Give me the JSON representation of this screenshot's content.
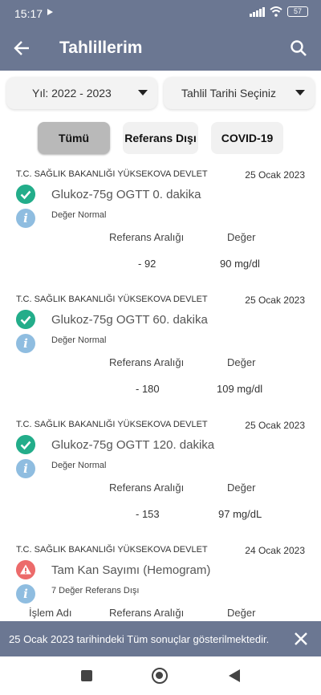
{
  "status_bar": {
    "time": "15:17",
    "battery": "57"
  },
  "app_bar": {
    "title": "Tahlillerim"
  },
  "filters": {
    "year": "Yıl: 2022 - 2023",
    "date": "Tahlil Tarihi Seçiniz"
  },
  "chips": [
    "Tümü",
    "Referans Dışı",
    "COVID-19"
  ],
  "results": [
    {
      "institution": "T.C. SAĞLIK BAKANLIĞI YÜKSEKOVA DEVLET",
      "date": "25 Ocak 2023",
      "test": "Glukoz-75g OGTT 0. dakika",
      "status": "ok",
      "info": "Değer Normal",
      "ref_header": "Referans Aralığı",
      "value_header": "Değer",
      "ref": "- 92",
      "value": "90 mg/dl"
    },
    {
      "institution": "T.C. SAĞLIK BAKANLIĞI YÜKSEKOVA DEVLET",
      "date": "25 Ocak 2023",
      "test": "Glukoz-75g OGTT 60. dakika",
      "status": "ok",
      "info": "Değer Normal",
      "ref_header": "Referans Aralığı",
      "value_header": "Değer",
      "ref": "- 180",
      "value": "109 mg/dl"
    },
    {
      "institution": "T.C. SAĞLIK BAKANLIĞI YÜKSEKOVA DEVLET",
      "date": "25 Ocak 2023",
      "test": "Glukoz-75g OGTT 120. dakika",
      "status": "ok",
      "info": "Değer Normal",
      "ref_header": "Referans Aralığı",
      "value_header": "Değer",
      "ref": "- 153",
      "value": "97 mg/dL"
    },
    {
      "institution": "T.C. SAĞLIK BAKANLIĞI YÜKSEKOVA DEVLET",
      "date": "24 Ocak 2023",
      "test": "Tam Kan Sayımı (Hemogram)",
      "status": "warn",
      "info": "7 Değer Referans Dışı",
      "name_header": "İşlem Adı",
      "ref_header": "Referans Aralığı",
      "value_header": "Değer"
    }
  ],
  "snackbar": {
    "text": "25 Ocak 2023 tarihindeki Tüm sonuçlar gösterilmektedir."
  },
  "colors": {
    "primary": "#6b7792",
    "ok": "#23ad8a",
    "warn": "#ec6b6b",
    "info": "#8fbde0",
    "chip_selected": "#b9b9b9"
  },
  "icons": {
    "back": "arrow-left-icon",
    "search": "search-icon",
    "ok": "check-circle-icon",
    "warn": "warning-icon",
    "info": "info-icon",
    "close": "close-icon"
  }
}
